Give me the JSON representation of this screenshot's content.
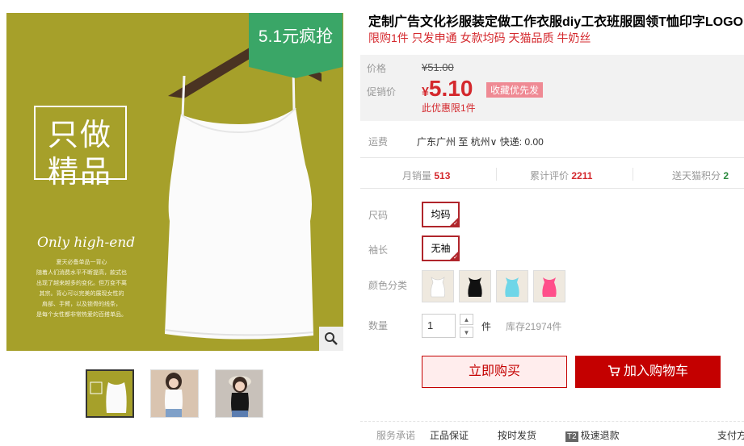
{
  "product": {
    "title": "定制广告文化衫服装定做工作衣服diy工衣班服圆领T恤印字LOGO",
    "subtitle": "限购1件 只发申通 女款均码 天猫品质 牛奶丝"
  },
  "main_image": {
    "promo_tag": "5.1元疯抢",
    "slogan_line1": "只做",
    "slogan_line2": "精品",
    "english": "Only high-end",
    "desc_lines": [
      "夏天必备单品一背心",
      "随着人们消费水平不断提高，款式也",
      "出现了越来越多的变化。但万变不离",
      "其宗。背心可以完美的展现女性的",
      "肩部、手臂，以及锁骨的线条，",
      "是每个女性都非常热爱的百搭单品。"
    ]
  },
  "price": {
    "orig_label": "价格",
    "orig_value": "¥51.00",
    "promo_label": "促销价",
    "currency": "¥",
    "promo_value": "5.10",
    "badge": "收藏优先发",
    "limit": "此优惠限1件"
  },
  "shipping": {
    "label": "运费",
    "text": "广东广州 至 杭州∨ 快递: 0.00"
  },
  "stats": {
    "monthly_label": "月销量",
    "monthly_value": "513",
    "reviews_label": "累计评价",
    "reviews_value": "2211",
    "points_label": "送天猫积分",
    "points_value": "2"
  },
  "options": {
    "size_label": "尺码",
    "size_value": "均码",
    "sleeve_label": "袖长",
    "sleeve_value": "无袖",
    "color_label": "颜色分类",
    "colors": [
      "#ffffff",
      "#111111",
      "#6fd6e8",
      "#ff4f8a"
    ]
  },
  "quantity": {
    "label": "数量",
    "value": "1",
    "unit": "件",
    "stock": "库存21974件"
  },
  "actions": {
    "buy_now": "立即购买",
    "add_cart": "加入购物车"
  },
  "service": {
    "label": "服务承诺",
    "items": [
      "正品保证",
      "按时发货",
      "极速退款",
      "支付方"
    ],
    "badge": "T2"
  }
}
